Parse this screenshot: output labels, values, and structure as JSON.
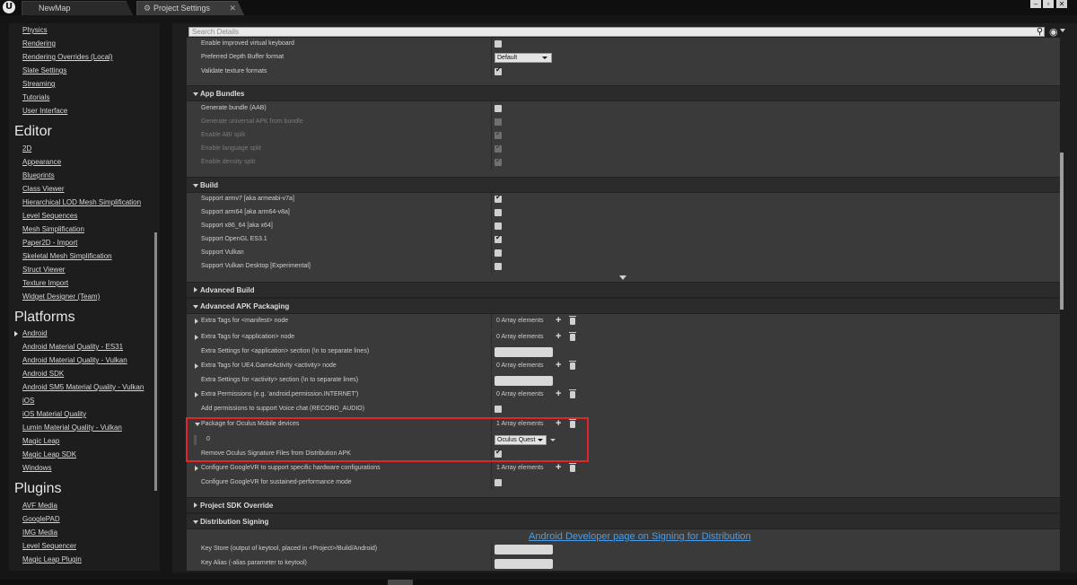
{
  "tabs": [
    {
      "label": "NewMap"
    },
    {
      "label": "Project Settings"
    }
  ],
  "search": {
    "placeholder": "Search Details"
  },
  "leftnav": {
    "engine_items": [
      "Physics",
      "Rendering",
      "Rendering Overrides (Local)",
      "Slate Settings",
      "Streaming",
      "Tutorials",
      "User Interface"
    ],
    "editor": {
      "title": "Editor",
      "items": [
        "2D",
        "Appearance",
        "Blueprints",
        "Class Viewer",
        "Hierarchical LOD Mesh Simplification",
        "Level Sequences",
        "Mesh Simplification",
        "Paper2D - Import",
        "Skeletal Mesh Simplification",
        "Struct Viewer",
        "Texture Import",
        "Widget Designer (Team)"
      ]
    },
    "platforms": {
      "title": "Platforms",
      "items": [
        "Android",
        "Android Material Quality - ES31",
        "Android Material Quality - Vulkan",
        "Android SDK",
        "Android SM5 Material Quality - Vulkan",
        "iOS",
        "iOS Material Quality",
        "Lumin Material Quality - Vulkan",
        "Magic Leap",
        "Magic Leap SDK",
        "Windows"
      ]
    },
    "plugins": {
      "title": "Plugins",
      "items": [
        "AVF Media",
        "GooglePAD",
        "IMG Media",
        "Level Sequencer",
        "Magic Leap Plugin"
      ]
    }
  },
  "details": {
    "top_rows": [
      {
        "label": "Enable improved virtual keyboard",
        "checked": false
      },
      {
        "label": "Preferred Depth Buffer format",
        "combo": "Default"
      },
      {
        "label": "Validate texture formats",
        "checked": true
      }
    ],
    "app_bundles": {
      "title": "App Bundles",
      "rows": [
        {
          "label": "Generate bundle (AAB)",
          "checked": false,
          "dim": false
        },
        {
          "label": "Generate universal APK from bundle",
          "checked": false,
          "dim": true
        },
        {
          "label": "Enable ABI split",
          "checked": true,
          "dim": true
        },
        {
          "label": "Enable language split",
          "checked": true,
          "dim": true
        },
        {
          "label": "Enable density split",
          "checked": true,
          "dim": true
        }
      ]
    },
    "build": {
      "title": "Build",
      "rows": [
        {
          "label": "Support armv7 [aka armeabi-v7a]",
          "checked": true
        },
        {
          "label": "Support arm64 [aka arm64-v8a]",
          "checked": false
        },
        {
          "label": "Support x86_64 [aka x64]",
          "checked": false
        },
        {
          "label": "Support OpenGL ES3.1",
          "checked": true
        },
        {
          "label": "Support Vulkan",
          "checked": false
        },
        {
          "label": "Support Vulkan Desktop [Experimental]",
          "checked": false
        }
      ]
    },
    "advanced_build": {
      "title": "Advanced Build"
    },
    "apk_packaging": {
      "title": "Advanced APK Packaging",
      "rows": [
        {
          "label": "Extra Tags for <manifest> node",
          "count": "0 Array elements"
        },
        {
          "label": "Extra Tags for <application> node",
          "count": "0 Array elements"
        },
        {
          "label": "Extra Settings for <application> section (\\n to separate lines)"
        },
        {
          "label": "Extra Tags for UE4.GameActivity <activity> node",
          "count": "0 Array elements"
        },
        {
          "label": "Extra Settings for <activity> section (\\n to separate lines)"
        },
        {
          "label": "Extra Permissions (e.g. 'android.permission.INTERNET')",
          "count": "0 Array elements"
        },
        {
          "label": "Add permissions to support Voice chat (RECORD_AUDIO)",
          "checked": false
        }
      ],
      "oculus": {
        "label": "Package for Oculus Mobile devices",
        "count": "1 Array elements",
        "index": "0",
        "value": "Oculus Quest",
        "remove_sig_label": "Remove Oculus Signature Files from Distribution APK",
        "remove_sig_checked": true
      },
      "googlevr": {
        "label": "Configure GoogleVR to support specific hardware configurations",
        "count": "1 Array elements"
      },
      "googlevr_perf": {
        "label": "Configure GoogleVR for sustained-performance mode",
        "checked": false
      }
    },
    "project_sdk": {
      "title": "Project SDK Override"
    },
    "distribution": {
      "title": "Distribution Signing",
      "link": "Android Developer page on Signing for Distribution",
      "rows": [
        {
          "label": "Key Store (output of keytool, placed in <Project>/Build/Android)"
        },
        {
          "label": "Key Alias (-alias parameter to keytool)"
        }
      ]
    }
  }
}
